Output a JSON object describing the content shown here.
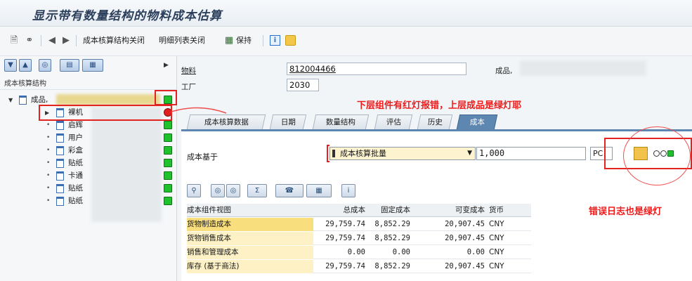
{
  "window": {
    "title": "显示带有数量结构的物料成本估算"
  },
  "toolbar": {
    "collapse_cost_structure": "成本核算结构关闭",
    "collapse_detail_list": "明细列表关闭",
    "hold": "保持"
  },
  "tree": {
    "header": "成本核算结构",
    "root": {
      "label": "成品,"
    },
    "items": [
      {
        "label": "裸机"
      },
      {
        "label": "启辉"
      },
      {
        "label": "用户"
      },
      {
        "label": "彩盒"
      },
      {
        "label": "贴纸"
      },
      {
        "label": "卡通"
      },
      {
        "label": "贴纸"
      },
      {
        "label": "贴纸"
      }
    ]
  },
  "header_fields": {
    "material_label": "物料",
    "material_value": "812004466",
    "plant_label": "工厂",
    "plant_value": "2030",
    "product_label": "成品,"
  },
  "annotations": {
    "top": "下层组件有红灯报错，上层成品是绿灯耶",
    "right": "错误日志也是绿灯"
  },
  "tabs": [
    "成本核算数据",
    "日期",
    "数量结构",
    "评估",
    "历史",
    "成本"
  ],
  "active_tab": "成本",
  "cost_basis": {
    "label": "成本基于",
    "value": "成本核算批量",
    "quantity": "1,000",
    "unit": "PC"
  },
  "grid": {
    "columns": [
      "成本组件视图",
      "总成本",
      "固定成本",
      "可变成本",
      "货币"
    ],
    "rows": [
      [
        "货物制造成本",
        "29,759.74",
        "8,852.29",
        "20,907.45",
        "CNY"
      ],
      [
        "货物销售成本",
        "29,759.74",
        "8,852.29",
        "20,907.45",
        "CNY"
      ],
      [
        "销售和管理成本",
        "0.00",
        "0.00",
        "0.00",
        "CNY"
      ],
      [
        "库存 (基于商法)",
        "29,759.74",
        "8,852.29",
        "20,907.45",
        "CNY"
      ]
    ]
  },
  "colors": {
    "annotation_red": "#ee1b1b",
    "status_green": "#1fc22c",
    "status_red": "#e01f1f",
    "active_tab": "#5d87b1"
  }
}
